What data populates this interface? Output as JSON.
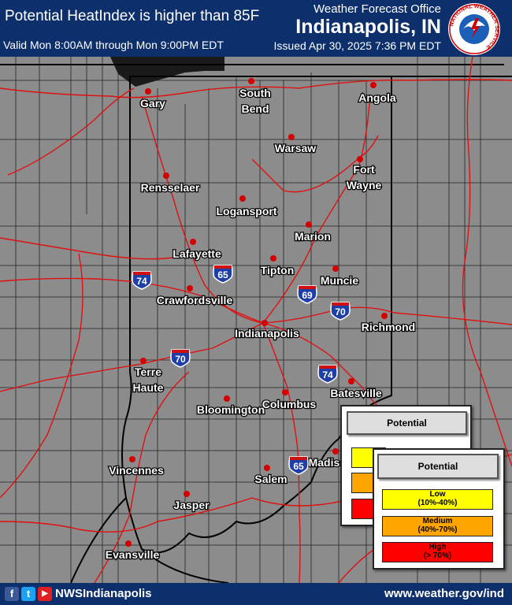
{
  "header": {
    "title": "Potential HeatIndex is higher than 85F",
    "valid": "Valid Mon 8:00AM through Mon 9:00PM EDT",
    "office_label": "Weather Forecast Office",
    "office_city": "Indianapolis, IN",
    "issued": "Issued Apr 30, 2025 7:36 PM EDT",
    "logo_text": "NATIONAL WEATHER SERVICE"
  },
  "cities": [
    {
      "name": "Gary",
      "l1": "Gary",
      "l2": ""
    },
    {
      "name": "South Bend",
      "l1": "South",
      "l2": "Bend"
    },
    {
      "name": "Angola",
      "l1": "Angola",
      "l2": ""
    },
    {
      "name": "Warsaw",
      "l1": "Warsaw",
      "l2": ""
    },
    {
      "name": "Fort Wayne",
      "l1": "Fort",
      "l2": "Wayne"
    },
    {
      "name": "Rensselaer",
      "l1": "Rensselaer",
      "l2": ""
    },
    {
      "name": "Logansport",
      "l1": "Logansport",
      "l2": ""
    },
    {
      "name": "Marion",
      "l1": "Marion",
      "l2": ""
    },
    {
      "name": "Lafayette",
      "l1": "Lafayette",
      "l2": ""
    },
    {
      "name": "Tipton",
      "l1": "Tipton",
      "l2": ""
    },
    {
      "name": "Muncie",
      "l1": "Muncie",
      "l2": ""
    },
    {
      "name": "Crawfordsville",
      "l1": "Crawfordsville",
      "l2": ""
    },
    {
      "name": "Indianapolis",
      "l1": "Indianapolis",
      "l2": ""
    },
    {
      "name": "Richmond",
      "l1": "Richmond",
      "l2": ""
    },
    {
      "name": "Terre Haute",
      "l1": "Terre",
      "l2": "Haute"
    },
    {
      "name": "Batesville",
      "l1": "Batesville",
      "l2": ""
    },
    {
      "name": "Bloomington",
      "l1": "Bloomington",
      "l2": ""
    },
    {
      "name": "Columbus",
      "l1": "Columbus",
      "l2": ""
    },
    {
      "name": "Vincennes",
      "l1": "Vincennes",
      "l2": ""
    },
    {
      "name": "Salem",
      "l1": "Salem",
      "l2": ""
    },
    {
      "name": "Madison",
      "l1": "Madison",
      "l2": ""
    },
    {
      "name": "Jasper",
      "l1": "Jasper",
      "l2": ""
    },
    {
      "name": "Evansville",
      "l1": "Evansville",
      "l2": ""
    }
  ],
  "interstates": [
    "74",
    "65",
    "69",
    "70",
    "70",
    "74",
    "65"
  ],
  "legend": {
    "title": "Potential",
    "items": [
      {
        "level": "Low",
        "range": "(10%-40%)",
        "color": "#ffff00"
      },
      {
        "level": "Medium",
        "range": "(40%-70%)",
        "color": "#ffa500"
      },
      {
        "level": "High",
        "range": "(> 70%)",
        "color": "#ff0000"
      }
    ]
  },
  "colors": {
    "background": "#8c8c8c",
    "header": "#0d2f6b",
    "roads": "#e01010",
    "borders": "#000000"
  },
  "footer": {
    "handle": "NWSIndianapolis",
    "url": "www.weather.gov/ind",
    "facebook_icon": "f",
    "twitter_icon": "t",
    "youtube_icon": "▶"
  }
}
